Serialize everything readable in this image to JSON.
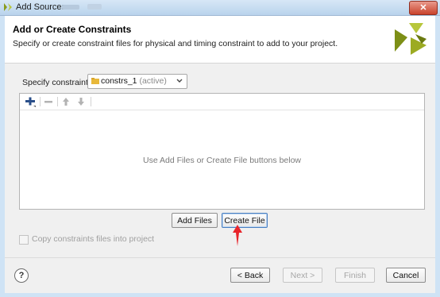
{
  "window": {
    "title": "Add Sources",
    "close_label": "✕"
  },
  "header": {
    "title": "Add or Create Constraints",
    "subtitle": "Specify or create constraint files for physical and timing constraint to add to your project."
  },
  "constraint_set": {
    "label": "Specify constraint set:",
    "value": "constrs_1",
    "status": "(active)"
  },
  "files_toolbar": {
    "add_icon": "plus-icon",
    "remove_icon": "minus-icon",
    "up_icon": "arrow-up-icon",
    "down_icon": "arrow-down-icon"
  },
  "files_area": {
    "empty_message": "Use Add Files or Create File buttons below"
  },
  "actions": {
    "add_files_label": "Add Files",
    "create_file_label": "Create File"
  },
  "options": {
    "copy_label": "Copy constraints files into project",
    "copy_checked": false
  },
  "footer": {
    "help_label": "?",
    "back_label": "< Back",
    "next_label": "Next >",
    "finish_label": "Finish",
    "cancel_label": "Cancel"
  },
  "colors": {
    "logo_primary": "#7a8c14",
    "logo_secondary": "#b6c53a",
    "annotation_arrow": "#e8252b",
    "focus_border": "#4a7fc1"
  }
}
